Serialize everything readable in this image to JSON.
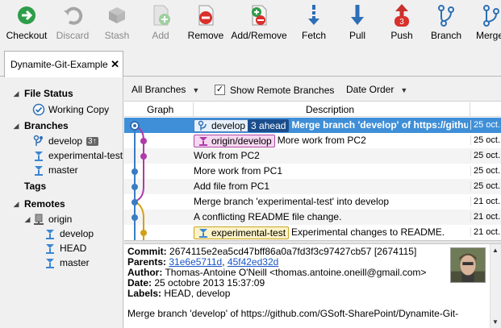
{
  "toolbar": {
    "checkout": "Checkout",
    "discard": "Discard",
    "stash": "Stash",
    "add": "Add",
    "remove": "Remove",
    "add_remove": "Add/Remove",
    "fetch": "Fetch",
    "pull": "Pull",
    "push": "Push",
    "push_count": "3",
    "branch": "Branch",
    "merge": "Merge"
  },
  "tab": {
    "title": "Dynamite-Git-Example",
    "close": "✕"
  },
  "sidebar": {
    "file_status": "File Status",
    "working_copy": "Working Copy",
    "branches": "Branches",
    "branch_items": [
      {
        "label": "develop",
        "badge": "3↑"
      },
      {
        "label": "experimental-test"
      },
      {
        "label": "master"
      }
    ],
    "tags": "Tags",
    "remotes": "Remotes",
    "remote_origin": "origin",
    "remote_items": [
      "develop",
      "HEAD",
      "master"
    ]
  },
  "filter": {
    "branches_select": "All Branches",
    "show_remote": "Show Remote Branches",
    "order_select": "Date Order"
  },
  "columns": {
    "graph": "Graph",
    "description": "Description"
  },
  "commits": [
    {
      "badge_local": "develop",
      "badge_ahead": "3 ahead",
      "message": "Merge branch 'develop' of https://githu",
      "date": "25 oct."
    },
    {
      "badge_remote": "origin/develop",
      "message": "More work from PC2",
      "date": "25 oct."
    },
    {
      "message": "Work from PC2",
      "date": "25 oct."
    },
    {
      "message": "More work from PC1",
      "date": "25 oct."
    },
    {
      "message": "Add file from PC1",
      "date": "25 oct."
    },
    {
      "message": "Merge branch 'experimental-test' into develop",
      "date": "21 oct."
    },
    {
      "message": "A conflicting README file change.",
      "date": "21 oct."
    },
    {
      "badge_exp": "experimental-test",
      "message": "Experimental changes to README.",
      "date": "21 oct."
    }
  ],
  "details": {
    "commit_label": "Commit:",
    "commit_value": "2674115e2ea5cd47bff86a0a7fd3f3c97427cb57 [2674115]",
    "parents_label": "Parents:",
    "parent1": "31e6e5711d",
    "parent_sep": ", ",
    "parent2": "45f42ed32d",
    "author_label": "Author:",
    "author_value": "Thomas-Antoine O'Neill <thomas.antoine.oneill@gmail.com>",
    "date_label": "Date:",
    "date_value": "25 octobre 2013 15:37:09",
    "labels_label": "Labels:",
    "labels_value": "HEAD, develop",
    "message": "Merge branch 'develop' of https://github.com/GSoft-SharePoint/Dynamite-Git-"
  },
  "colors": {
    "selection": "#3f8fd8",
    "graph_blue": "#3a7cc2",
    "graph_magenta": "#b03aa8",
    "graph_yellow": "#d4a017"
  }
}
